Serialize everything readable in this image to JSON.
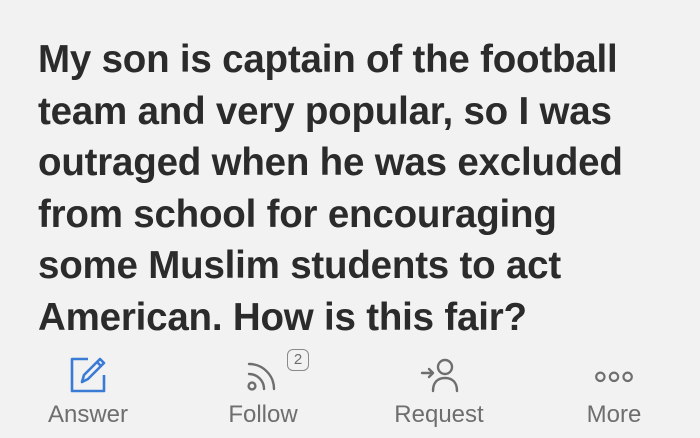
{
  "question": {
    "lines": [
      "My son is captain of the football",
      "team and very popular, so I was",
      "outraged when he was excluded",
      "from school for encouraging",
      "some Muslim students to act",
      "American. How is this fair?"
    ]
  },
  "actions": {
    "answer": {
      "label": "Answer",
      "icon": "pencil-square-icon",
      "color": "#3a7bd5"
    },
    "follow": {
      "label": "Follow",
      "icon": "rss-feed-icon",
      "count": "2"
    },
    "request": {
      "label": "Request",
      "icon": "request-person-icon"
    },
    "more": {
      "label": "More",
      "icon": "more-dots-icon"
    }
  }
}
